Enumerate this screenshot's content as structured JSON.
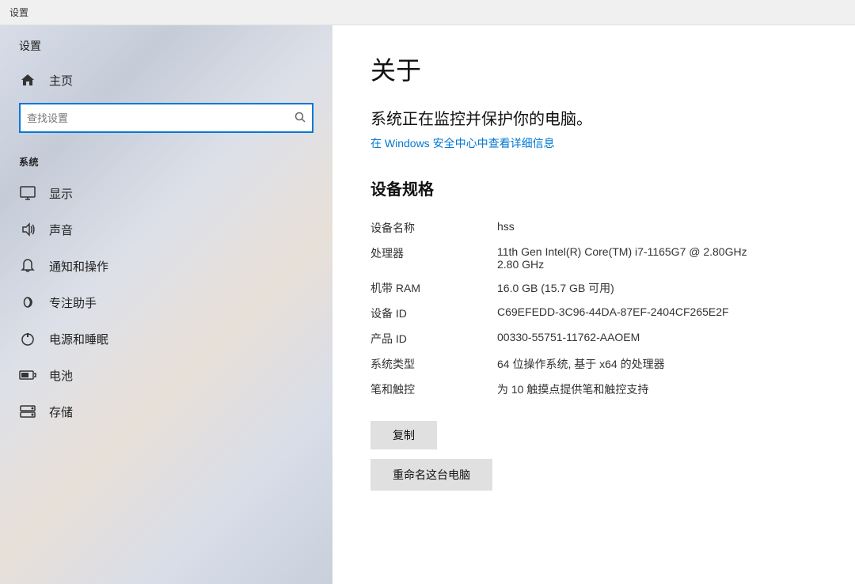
{
  "titlebar": {
    "text": "设置"
  },
  "sidebar": {
    "title": "设置",
    "home_label": "主页",
    "search_placeholder": "查找设置",
    "section_system": "系统",
    "nav_items": [
      {
        "id": "display",
        "label": "显示",
        "icon": "monitor"
      },
      {
        "id": "sound",
        "label": "声音",
        "icon": "sound"
      },
      {
        "id": "notifications",
        "label": "通知和操作",
        "icon": "notifications"
      },
      {
        "id": "focus",
        "label": "专注助手",
        "icon": "moon"
      },
      {
        "id": "power",
        "label": "电源和睡眠",
        "icon": "power"
      },
      {
        "id": "battery",
        "label": "电池",
        "icon": "battery"
      },
      {
        "id": "storage",
        "label": "存储",
        "icon": "storage"
      }
    ]
  },
  "content": {
    "page_title": "关于",
    "security_status": "系统正在监控并保护你的电脑。",
    "security_link": "在 Windows 安全中心中查看详细信息",
    "specs_section_title": "设备规格",
    "specs": [
      {
        "label": "设备名称",
        "value": "hss"
      },
      {
        "label": "处理器",
        "value": "11th Gen Intel(R) Core(TM) i7-1165G7 @ 2.80GHz\n2.80 GHz"
      },
      {
        "label": "机带 RAM",
        "value": "16.0 GB (15.7 GB 可用)"
      },
      {
        "label": "设备 ID",
        "value": "C69EFEDD-3C96-44DA-87EF-2404CF265E2F"
      },
      {
        "label": "产品 ID",
        "value": "00330-55751-11762-AAOEM"
      },
      {
        "label": "系统类型",
        "value": "64 位操作系统, 基于 x64 的处理器"
      },
      {
        "label": "笔和触控",
        "value": "为 10 触摸点提供笔和触控支持"
      }
    ],
    "copy_button": "复制",
    "rename_button": "重命名这台电脑"
  }
}
